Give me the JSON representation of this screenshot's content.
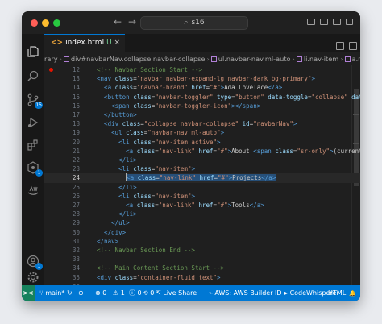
{
  "titlebar": {
    "search_text": "s16",
    "back_arrow": "←",
    "forward_arrow": "→"
  },
  "tab": {
    "icon_text": "<>",
    "filename": "index.html",
    "modified_marker": "U",
    "close": "×"
  },
  "breadcrumb": {
    "items": [
      "rary",
      "div#navbarNav.collapse.navbar-collapse",
      "ul.navbar-nav.ml-auto",
      "li.nav-item",
      "a.nav-link"
    ]
  },
  "activity_badges": {
    "source_control": "15",
    "remote": "1",
    "accounts": "1"
  },
  "editor": {
    "current_line": 24,
    "breakpoint_line": 12,
    "lines": [
      {
        "n": "12",
        "segs": [
          [
            "c",
            "  <!-- Navbar Section Start -->"
          ]
        ]
      },
      {
        "n": "13",
        "segs": [
          [
            "t",
            "  <nav "
          ],
          [
            "a",
            "class"
          ],
          [
            "x",
            "="
          ],
          [
            "s",
            "\"navbar navbar-expand-lg navbar-dark bg-primary\""
          ],
          [
            "t",
            ">"
          ]
        ]
      },
      {
        "n": "14",
        "segs": [
          [
            "t",
            "    <a "
          ],
          [
            "a",
            "class"
          ],
          [
            "x",
            "="
          ],
          [
            "s",
            "\"navbar-brand\""
          ],
          [
            "a",
            " href"
          ],
          [
            "x",
            "="
          ],
          [
            "s",
            "\"#\""
          ],
          [
            "t",
            ">"
          ],
          [
            "x",
            "Ada Lovelace"
          ],
          [
            "t",
            "</a>"
          ]
        ]
      },
      {
        "n": "15",
        "segs": [
          [
            "t",
            "    <button "
          ],
          [
            "a",
            "class"
          ],
          [
            "x",
            "="
          ],
          [
            "s",
            "\"navbar-toggler\""
          ],
          [
            "a",
            " type"
          ],
          [
            "x",
            "="
          ],
          [
            "s",
            "\"button\""
          ],
          [
            "a",
            " data-toggle"
          ],
          [
            "x",
            "="
          ],
          [
            "s",
            "\"collapse\""
          ],
          [
            "a",
            " data-targe"
          ]
        ]
      },
      {
        "n": "16",
        "segs": [
          [
            "t",
            "      <span "
          ],
          [
            "a",
            "class"
          ],
          [
            "x",
            "="
          ],
          [
            "s",
            "\"navbar-toggler-icon\""
          ],
          [
            "t",
            "></span>"
          ]
        ]
      },
      {
        "n": "17",
        "segs": [
          [
            "t",
            "    </button>"
          ]
        ]
      },
      {
        "n": "18",
        "segs": [
          [
            "t",
            "    <div "
          ],
          [
            "a",
            "class"
          ],
          [
            "x",
            "="
          ],
          [
            "s",
            "\"collapse navbar-collapse\""
          ],
          [
            "a",
            " id"
          ],
          [
            "x",
            "="
          ],
          [
            "s",
            "\"navbarNav\""
          ],
          [
            "t",
            ">"
          ]
        ]
      },
      {
        "n": "19",
        "segs": [
          [
            "t",
            "      <ul "
          ],
          [
            "a",
            "class"
          ],
          [
            "x",
            "="
          ],
          [
            "s",
            "\"navbar-nav ml-auto\""
          ],
          [
            "t",
            ">"
          ]
        ]
      },
      {
        "n": "20",
        "segs": [
          [
            "t",
            "        <li "
          ],
          [
            "a",
            "class"
          ],
          [
            "x",
            "="
          ],
          [
            "s",
            "\"nav-item active\""
          ],
          [
            "t",
            ">"
          ]
        ]
      },
      {
        "n": "21",
        "segs": [
          [
            "t",
            "          <a "
          ],
          [
            "a",
            "class"
          ],
          [
            "x",
            "="
          ],
          [
            "s",
            "\"nav-link\""
          ],
          [
            "a",
            " href"
          ],
          [
            "x",
            "="
          ],
          [
            "s",
            "\"#\""
          ],
          [
            "t",
            ">"
          ],
          [
            "x",
            "About "
          ],
          [
            "t",
            "<span "
          ],
          [
            "a",
            "class"
          ],
          [
            "x",
            "="
          ],
          [
            "s",
            "\"sr-only\""
          ],
          [
            "t",
            ">"
          ],
          [
            "x",
            "(current)"
          ],
          [
            "t",
            "</span"
          ]
        ]
      },
      {
        "n": "22",
        "segs": [
          [
            "t",
            "        </li>"
          ]
        ]
      },
      {
        "n": "23",
        "segs": [
          [
            "t",
            "        <li "
          ],
          [
            "a",
            "class"
          ],
          [
            "x",
            "="
          ],
          [
            "s",
            "\"nav-item\""
          ],
          [
            "t",
            ">"
          ]
        ]
      },
      {
        "n": "24",
        "segs": [
          [
            "x",
            "          "
          ],
          [
            "t",
            "<a "
          ],
          [
            "a",
            "class"
          ],
          [
            "x",
            "="
          ],
          [
            "s",
            "\"nav-link\""
          ],
          [
            "a",
            " href"
          ],
          [
            "x",
            "="
          ],
          [
            "s",
            "\"#\""
          ],
          [
            "t",
            ">"
          ],
          [
            "x",
            "Projects"
          ],
          [
            "t",
            "</a>"
          ]
        ]
      },
      {
        "n": "25",
        "segs": [
          [
            "t",
            "        </li>"
          ]
        ]
      },
      {
        "n": "26",
        "segs": [
          [
            "t",
            "        <li "
          ],
          [
            "a",
            "class"
          ],
          [
            "x",
            "="
          ],
          [
            "s",
            "\"nav-item\""
          ],
          [
            "t",
            ">"
          ]
        ]
      },
      {
        "n": "27",
        "segs": [
          [
            "t",
            "          <a "
          ],
          [
            "a",
            "class"
          ],
          [
            "x",
            "="
          ],
          [
            "s",
            "\"nav-link\""
          ],
          [
            "a",
            " href"
          ],
          [
            "x",
            "="
          ],
          [
            "s",
            "\"#\""
          ],
          [
            "t",
            ">"
          ],
          [
            "x",
            "Tools"
          ],
          [
            "t",
            "</a>"
          ]
        ]
      },
      {
        "n": "28",
        "segs": [
          [
            "t",
            "        </li>"
          ]
        ]
      },
      {
        "n": "29",
        "segs": [
          [
            "t",
            "      </ul>"
          ]
        ]
      },
      {
        "n": "30",
        "segs": [
          [
            "t",
            "    </div>"
          ]
        ]
      },
      {
        "n": "31",
        "segs": [
          [
            "t",
            "  </nav>"
          ]
        ]
      },
      {
        "n": "32",
        "segs": [
          [
            "c",
            "  <!-- Navbar Section End -->"
          ]
        ]
      },
      {
        "n": "33",
        "segs": []
      },
      {
        "n": "34",
        "segs": [
          [
            "c",
            "  <!-- Main Content Section Start -->"
          ]
        ]
      },
      {
        "n": "35",
        "segs": [
          [
            "t",
            "  <div "
          ],
          [
            "a",
            "class"
          ],
          [
            "x",
            "="
          ],
          [
            "s",
            "\"container-fluid text\""
          ],
          [
            "t",
            ">"
          ]
        ]
      },
      {
        "n": "36",
        "segs": []
      },
      {
        "n": "37",
        "segs": [
          [
            "t",
            "  </div>"
          ]
        ]
      }
    ]
  },
  "statusbar": {
    "remote_icon": "><",
    "branch": "main*",
    "sync": "↻",
    "publish": "⊕",
    "errors": "⊗ 0",
    "warnings": "⚠ 1",
    "info": "ⓘ 0",
    "ports": "⟲ 0",
    "live_share": "Live Share",
    "aws": "AWS: AWS Builder ID",
    "codewhisperer": "CodeWhisperer",
    "language": "HTML",
    "bell": "🔔"
  }
}
